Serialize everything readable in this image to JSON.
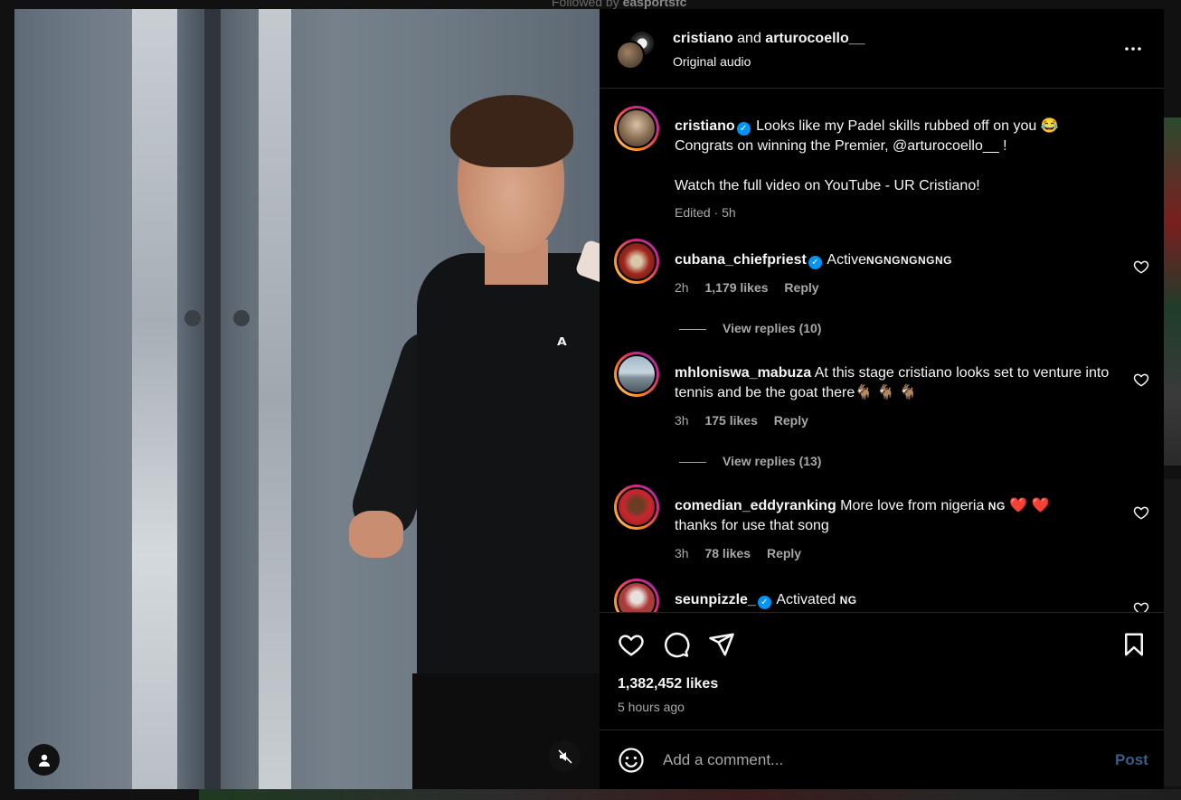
{
  "background": {
    "followed_by_prefix": "Followed by",
    "followed_by_user": "easportsfc"
  },
  "header": {
    "user1": "cristiano",
    "and": "and",
    "user2": "arturocoello__",
    "audio": "Original audio",
    "more_icon": "more-horizontal-icon"
  },
  "caption": {
    "user": "cristiano",
    "line1": "Looks like my Padel skills rubbed off on you 😂",
    "line2": "Congrats on winning the Premier, @arturocoello__ !",
    "line3": "Watch the full video on YouTube - UR Cristiano!",
    "meta": "Edited · 5h"
  },
  "comments": [
    {
      "user": "cubana_chiefpriest",
      "verified": true,
      "text": "Active",
      "flags": "NGNGNGNGNG",
      "time": "2h",
      "likes": "1,179 likes",
      "reply": "Reply",
      "view_replies": "View replies (10)"
    },
    {
      "user": "mhloniswa_mabuza",
      "verified": false,
      "text": "At this stage cristiano looks set to venture into tennis and be the goat there🐐 🐐 🐐",
      "time": "3h",
      "likes": "175 likes",
      "reply": "Reply",
      "view_replies": "View replies (13)"
    },
    {
      "user": "comedian_eddyranking",
      "verified": false,
      "text": "More love from nigeria",
      "flag": "NG",
      "hearts": "❤️ ❤️",
      "text2": "thanks for use that song",
      "time": "3h",
      "likes": "78 likes",
      "reply": "Reply"
    },
    {
      "user": "seunpizzle_",
      "verified": true,
      "text": "Activated",
      "flag": "NG"
    }
  ],
  "actions": {
    "likes": "1,382,452 likes",
    "time": "5 hours ago"
  },
  "add_comment": {
    "placeholder": "Add a comment...",
    "post": "Post"
  },
  "colors": {
    "panel_bg": "#000000",
    "text": "#f5f5f5",
    "muted": "#a8a8a8",
    "verified": "#0095f6",
    "post_disabled": "#3a5e86"
  }
}
